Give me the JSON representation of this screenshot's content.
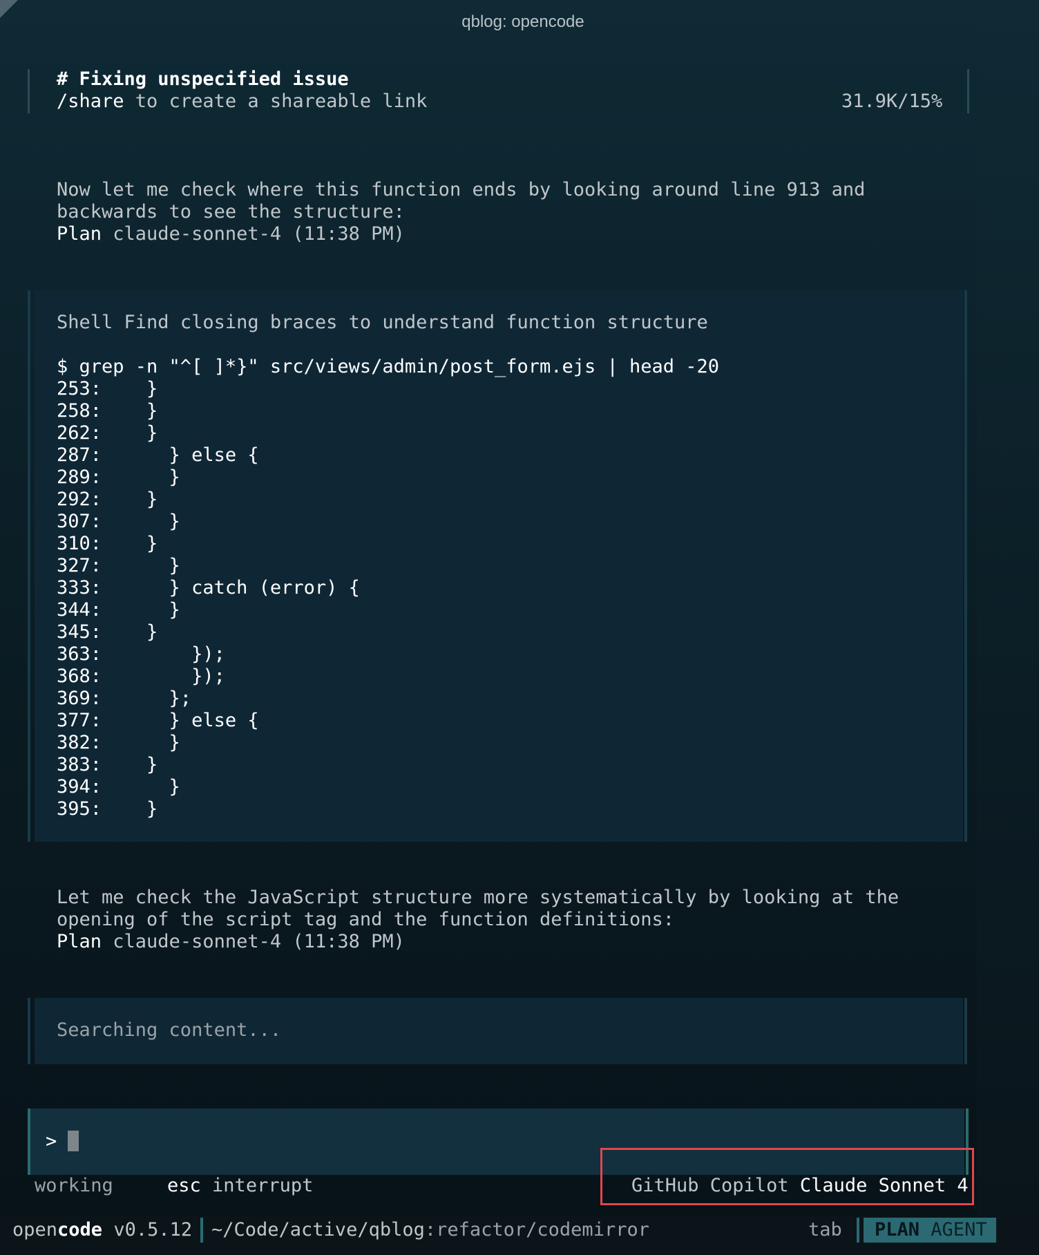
{
  "window": {
    "title": "qblog: opencode"
  },
  "session": {
    "title": "# Fixing unspecified issue",
    "share_cmd": "/share",
    "share_rest": " to create a shareable link",
    "usage": "31.9K/15%"
  },
  "message1": {
    "line1": "Now let me check where this function ends by looking around line 913 and",
    "line2": "backwards to see the structure:",
    "mode": "Plan",
    "meta": " claude-sonnet-4 (11:38 PM)"
  },
  "shell_tool": {
    "label": "Shell",
    "description": " Find closing braces to understand function structure",
    "command": "$ grep -n \"^[ ]*}\" src/views/admin/post_form.ejs | head -20",
    "output": [
      "253:    }",
      "258:    }",
      "262:    }",
      "287:      } else {",
      "289:      }",
      "292:    }",
      "307:      }",
      "310:    }",
      "327:      }",
      "333:      } catch (error) {",
      "344:      }",
      "345:    }",
      "363:        });",
      "368:        });",
      "369:      };",
      "377:      } else {",
      "382:      }",
      "383:    }",
      "394:      }",
      "395:    }"
    ]
  },
  "message2": {
    "line1": "Let me check the JavaScript structure more systematically by looking at the",
    "line2": "opening of the script tag and the function definitions:",
    "mode": "Plan",
    "meta": " claude-sonnet-4 (11:38 PM)"
  },
  "search_tool": {
    "status": "Searching content..."
  },
  "input": {
    "prompt": ">"
  },
  "footer": {
    "status": "working",
    "esc_key": "esc",
    "esc_action": "interrupt",
    "provider": "GitHub Copilot",
    "model": "Claude Sonnet 4"
  },
  "statusbar": {
    "app_open": "open",
    "app_code": "code",
    "version": "v0.5.12",
    "path": "~/Code/active/qblog",
    "branch": ":refactor/codemirror",
    "tab_hint": "tab",
    "agent_plan": "PLAN",
    "agent_label": "AGENT"
  },
  "colors": {
    "background": "#0c2029",
    "panel": "#0f2735",
    "accent": "#2b6a72",
    "highlight_border": "#e0474d"
  }
}
